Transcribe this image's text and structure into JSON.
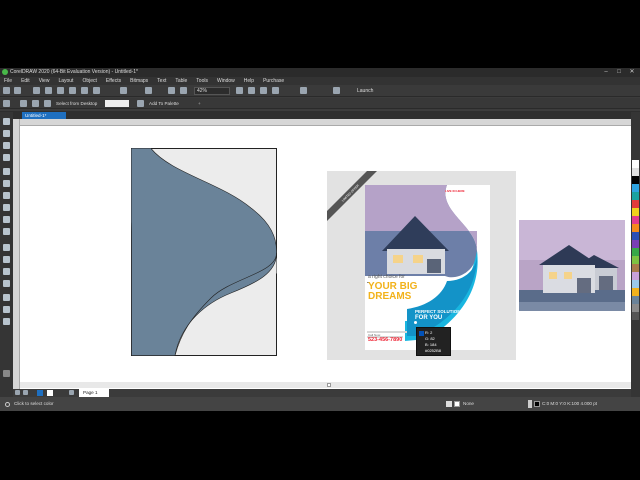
{
  "app": {
    "title": "CorelDRAW 2020 (64-Bit Evaluation Version) - Untitled-1*",
    "window_controls": [
      "–",
      "□",
      "✕"
    ]
  },
  "menu": [
    "File",
    "Edit",
    "View",
    "Layout",
    "Object",
    "Effects",
    "Bitmaps",
    "Text",
    "Table",
    "Tools",
    "Window",
    "Help",
    "Purchase"
  ],
  "toolbar": {
    "zoom_value": "42%",
    "launch_label": "Launch"
  },
  "property_bar": {
    "select_from_desktop": "Select from Desktop",
    "add_to_palette": "Add To Palette"
  },
  "document_tab": "Untitled-1*",
  "page_tab": "Page 1",
  "status": {
    "left_text": "Click to select color",
    "fill_label": "None",
    "color_readout": "C:0 M:0 Y:0 K:100  4.000 pt"
  },
  "flyer": {
    "badge": "LIMITED OFFER",
    "top_label": "LIVE IN HERE",
    "tagline": "a right choice for",
    "headline1": "YOUR BIG",
    "headline2": "DREAMS",
    "solution1": "PERFECT SOLUTION",
    "solution2": "FOR YOU",
    "phone_label": "Call Now:",
    "phone": "523-456-7890"
  },
  "color_tooltip": {
    "r": "R: 2",
    "g": "G: 82",
    "b": "B: 184",
    "hex": "#0252B8"
  },
  "colors": {
    "accent_blue": "#1e6fc0",
    "shape_fill": "#6a8399",
    "flyer_cyan": "#19b6e0",
    "flyer_yellow": "#f2b21b"
  }
}
